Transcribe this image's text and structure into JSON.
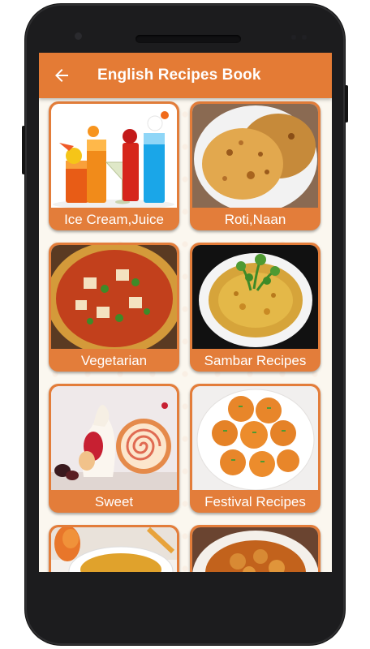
{
  "app_bar": {
    "title": "English Recipes Book",
    "back_icon": "arrow-left-icon",
    "color": "#e47b35"
  },
  "categories": [
    {
      "label": "Ice Cream,Juice",
      "image": "juice-glasses-image"
    },
    {
      "label": "Roti,Naan",
      "image": "roti-image"
    },
    {
      "label": "Vegetarian",
      "image": "paneer-curry-image"
    },
    {
      "label": "Sambar Recipes",
      "image": "sambar-bowl-image"
    },
    {
      "label": "Sweet",
      "image": "cake-roll-image"
    },
    {
      "label": "Festival Recipes",
      "image": "laddoo-plate-image"
    },
    {
      "label": "",
      "image": "rice-dish-image"
    },
    {
      "label": "",
      "image": "potato-curry-image"
    }
  ],
  "colors": {
    "card": "#e37d3a",
    "background": "#fbf7ef"
  }
}
